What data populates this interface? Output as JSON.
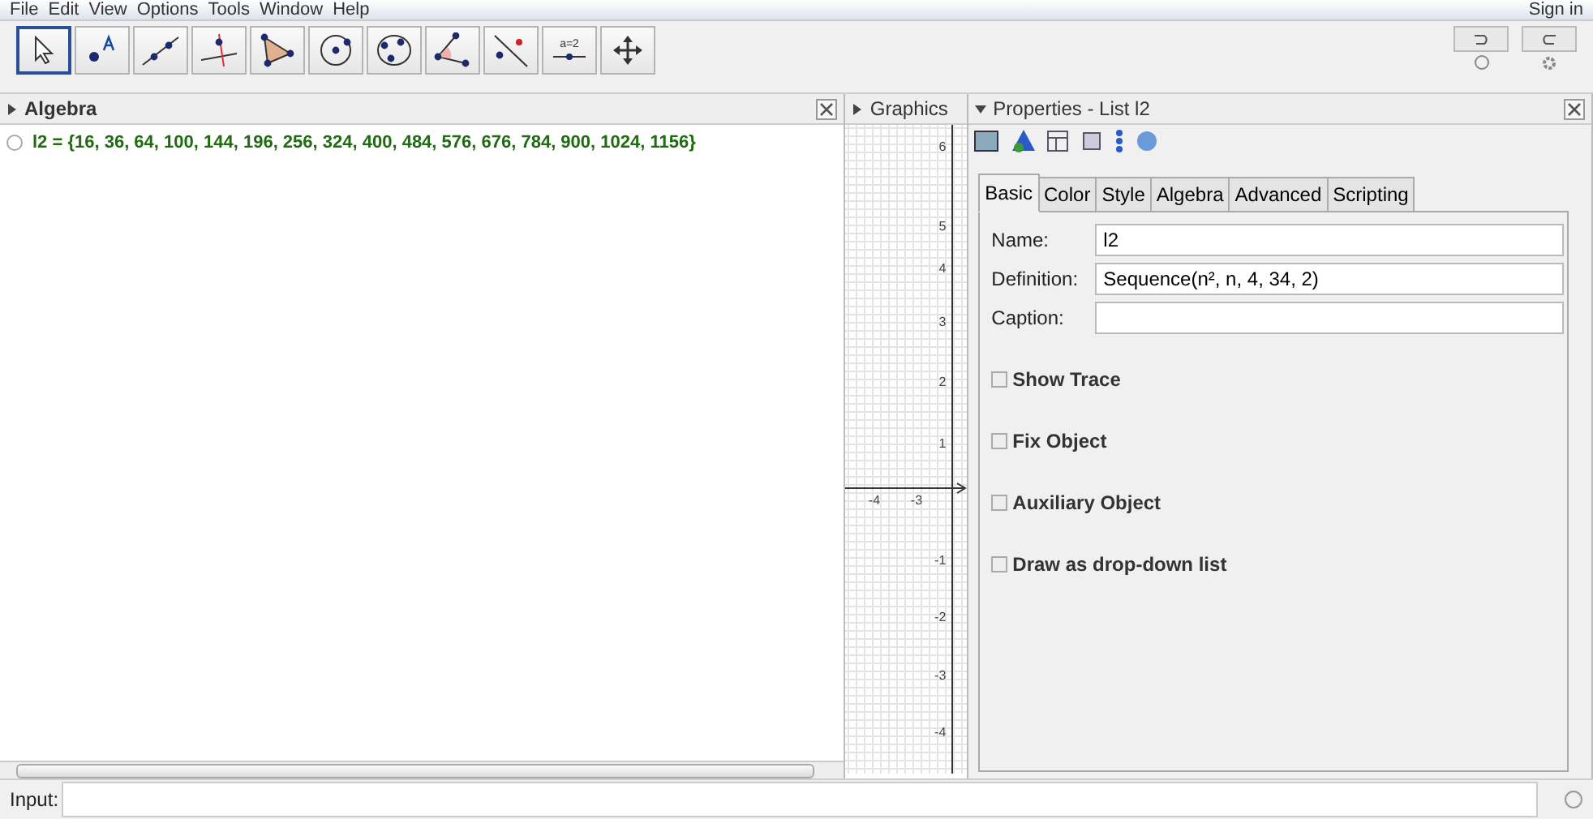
{
  "menu": [
    "File",
    "Edit",
    "View",
    "Options",
    "Tools",
    "Window",
    "Help"
  ],
  "sign_in": "Sign in",
  "tools": [
    {
      "kind": "move",
      "selected": true
    },
    {
      "kind": "point",
      "selected": false
    },
    {
      "kind": "line",
      "selected": false
    },
    {
      "kind": "perpendicular",
      "selected": false
    },
    {
      "kind": "polygon",
      "selected": false
    },
    {
      "kind": "circle",
      "selected": false
    },
    {
      "kind": "conic",
      "selected": false
    },
    {
      "kind": "angle",
      "selected": false
    },
    {
      "kind": "reflect",
      "selected": false
    },
    {
      "kind": "slider",
      "selected": false,
      "label": "a=2"
    },
    {
      "kind": "pan",
      "selected": false
    }
  ],
  "algebra": {
    "title": "Algebra",
    "items": [
      {
        "text": "l2 = {16, 36, 64, 100, 144, 196, 256, 324, 400, 484, 576, 676, 784, 900, 1024, 1156}",
        "shown": false
      }
    ]
  },
  "graphics": {
    "title": "Graphics",
    "y_labels": [
      "6",
      "5",
      "4",
      "3",
      "2",
      "1",
      "-1",
      "-2",
      "-3",
      "-4"
    ],
    "x_labels": [
      "-4",
      "-3"
    ]
  },
  "properties": {
    "title": "Properties - List l2",
    "tabs": [
      {
        "label": "Basic",
        "selected": true
      },
      {
        "label": "Color",
        "selected": false
      },
      {
        "label": "Style",
        "selected": false
      },
      {
        "label": "Algebra",
        "selected": false
      },
      {
        "label": "Advanced",
        "selected": false
      },
      {
        "label": "Scripting",
        "selected": false
      }
    ],
    "fields": [
      {
        "label": "Name:",
        "value": "l2"
      },
      {
        "label": "Definition:",
        "value": "Sequence(n², n, 4, 34, 2)"
      },
      {
        "label": "Caption:"
      }
    ],
    "checkboxes": [
      {
        "label": "Show Trace",
        "checked": false
      },
      {
        "label": "Fix Object",
        "checked": false
      },
      {
        "label": "Auxiliary Object",
        "checked": false
      },
      {
        "label": "Draw as drop-down list",
        "checked": false
      }
    ]
  },
  "input": {
    "label": "Input:"
  }
}
